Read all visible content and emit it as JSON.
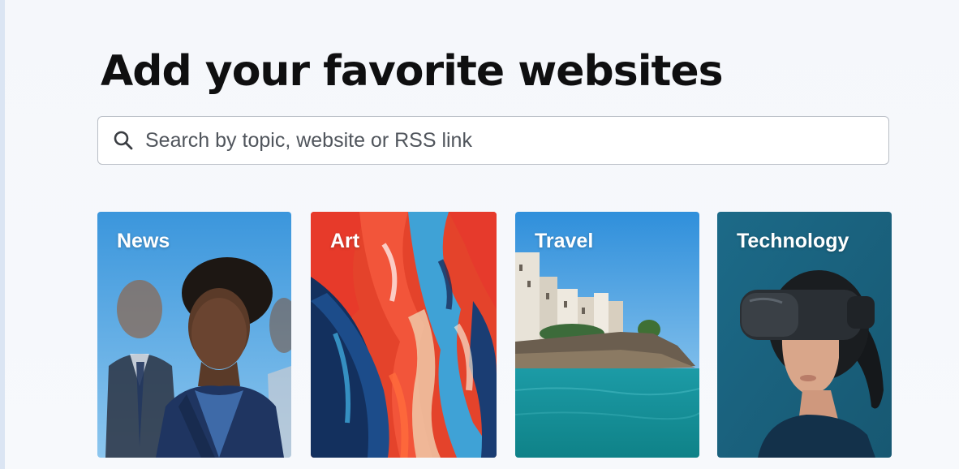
{
  "page": {
    "title": "Add your favorite websites"
  },
  "search": {
    "placeholder": "Search by topic, website or RSS link",
    "icon": "search-icon"
  },
  "categories": [
    {
      "label": "News",
      "image": "business-people-photo"
    },
    {
      "label": "Art",
      "image": "abstract-brush-strokes-painting"
    },
    {
      "label": "Travel",
      "image": "coastal-cliff-town-sea"
    },
    {
      "label": "Technology",
      "image": "woman-vr-headset"
    }
  ],
  "colors": {
    "background": "#f5f7fb",
    "title": "#0f0f10",
    "search_border": "#b9bec6",
    "news_bg": "#4a9fe0",
    "travel_sky": "#3d9be0",
    "travel_sea": "#1aa0a8",
    "tech_bg": "#1d6f8c"
  }
}
